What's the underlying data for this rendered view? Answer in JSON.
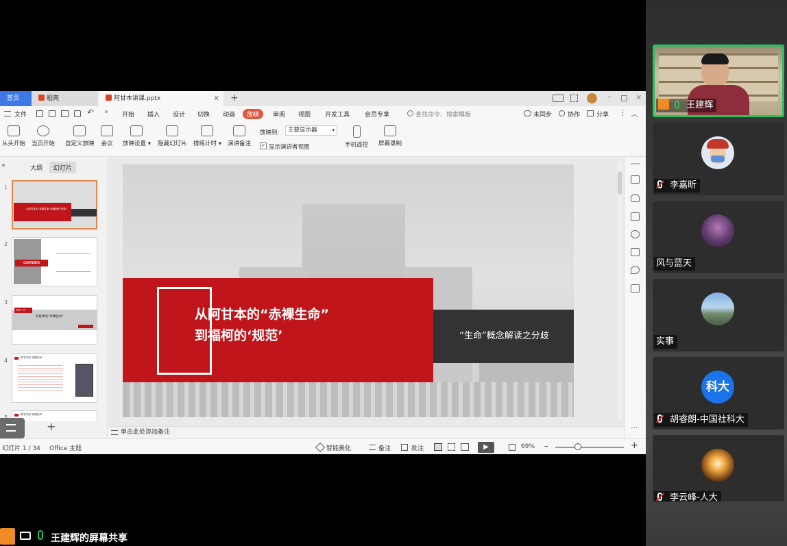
{
  "wps": {
    "tabs": {
      "home": "首页",
      "daoke": "稻壳",
      "file": "阿甘本讲课.pptx"
    },
    "menu": {
      "file": "文件",
      "items": [
        "开始",
        "插入",
        "设计",
        "切换",
        "动画",
        "放映",
        "审阅",
        "视图",
        "开发工具",
        "会员专享"
      ],
      "active": "放映",
      "search_placeholder": "查找命令、搜索模板",
      "unsynced": "未同步",
      "collab": "协作",
      "share": "分享"
    },
    "ribbon": {
      "from_start": "从头开始",
      "from_current": "当页开始",
      "custom_show": "自定义放映",
      "meeting": "会议",
      "show_settings": "放映设置",
      "hide_slide": "隐藏幻灯片",
      "rehearse": "排练计时",
      "speaker_notes": "演讲备注",
      "show_to_label": "放映到:",
      "show_to_value": "主要显示器",
      "presenter_view": "显示演讲者视图",
      "phone_remote": "手机遥控",
      "screen_record": "屏幕录制"
    },
    "panel": {
      "outline_tab": "大纲",
      "slides_tab": "幻灯片"
    },
    "thumbs": [
      "1",
      "2",
      "3",
      "4",
      "5"
    ],
    "thumb_texts": {
      "t1_title": "从阿甘本的“赤裸生命”到福柯的“规范”",
      "t2_contents": "CONTENTS",
      "t3_part": "PART 01",
      "t3_title": "阿甘本的“赤裸生命”",
      "t4_title": "“阿甘本的”赤裸生命”",
      "t5_title": "“阿甘本的”赤裸生命”"
    },
    "slide": {
      "title_line1": "从阿甘本的“赤裸生命”",
      "title_line2": "到福柯的‘规范’",
      "subtitle": "“生命”概念解读之分歧"
    },
    "notes_placeholder": "单击此处添加备注",
    "status": {
      "slide_count": "幻灯片 1 / 34",
      "theme": "Office 主题",
      "beautify": "智能美化",
      "notes": "备注",
      "comments": "批注",
      "zoom": "69%"
    }
  },
  "screen_share_label": "王建辉的屏幕共享",
  "participants": [
    {
      "name": "王建辉",
      "muted": false,
      "active": true
    },
    {
      "name": "李嘉昕",
      "muted": true
    },
    {
      "name": "风与蓝天",
      "muted": false
    },
    {
      "name": "实事",
      "muted": false
    },
    {
      "name": "胡睿朗-中国社科大",
      "muted": true,
      "avatar_text": "科大"
    },
    {
      "name": "李云峰-人大",
      "muted": true
    }
  ],
  "colors": {
    "accent_red": "#c0151b",
    "active_border": "#22c55e",
    "tab_blue": "#3d78e6",
    "avatar_blue": "#1a73e8"
  }
}
